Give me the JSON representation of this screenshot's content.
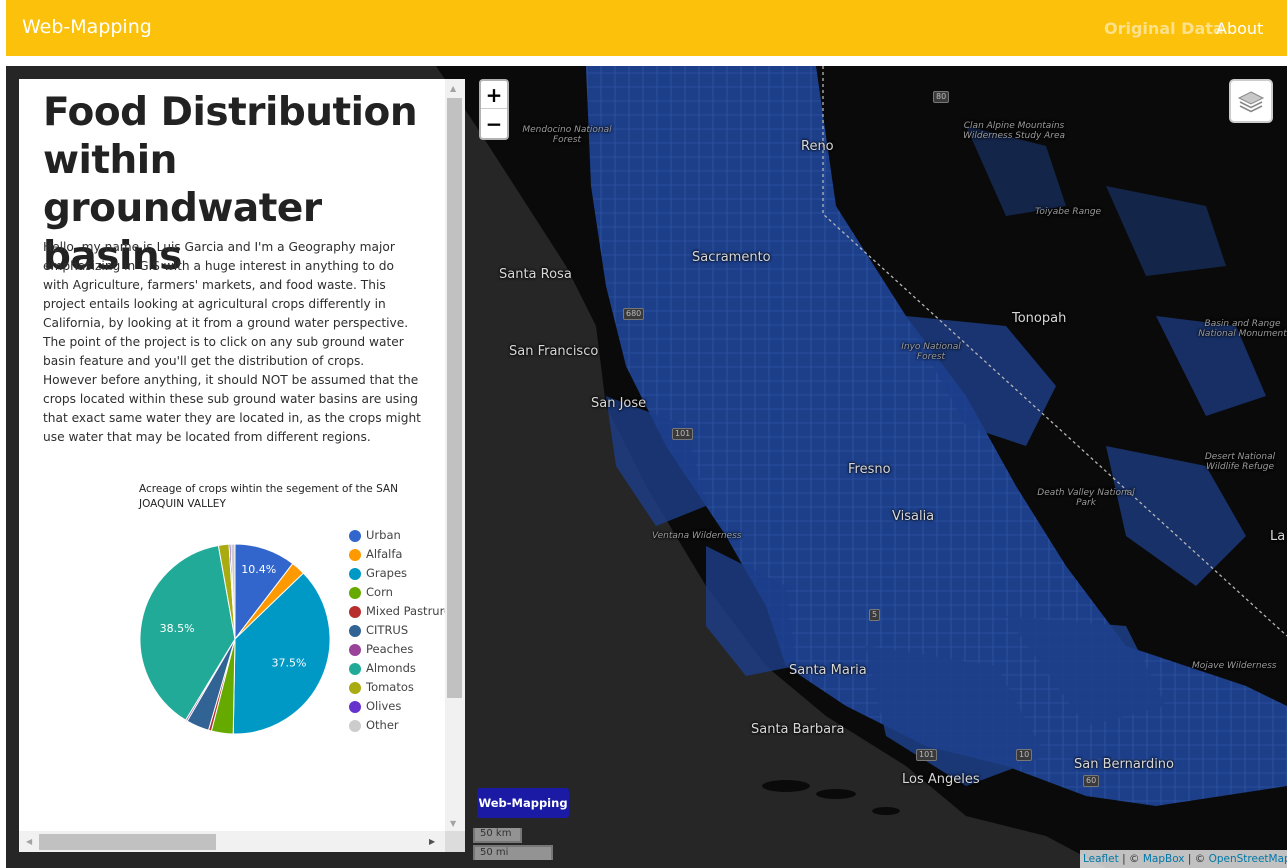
{
  "navbar": {
    "brand": "Web-Mapping",
    "links": [
      "Original Data",
      "About"
    ],
    "color": "#fcc10a"
  },
  "sidebar": {
    "title": "Food Distribution within groundwater basins",
    "intro": "Hello, my name is Luis Garcia and I'm a Geography major emphasizing in GIS with a huge interest in anything to do with Agriculture, farmers' markets, and food waste. This project entails looking at agricultural crops differently in California, by looking at it from a ground water perspective. The point of the project is to click on any sub ground water basin feature and you'll get the distribution of crops. However before anything, it should NOT be assumed that the crops located within these sub ground water basins are using that exact same water they are located in, as the crops might use water that may be located from different regions."
  },
  "chart_data": {
    "type": "pie",
    "title": "Acreage of crops wihtin the segement of the SAN JOAQUIN VALLEY",
    "labels": [
      "Urban",
      "Alfalfa",
      "Grapes",
      "Corn",
      "Mixed Pastrure",
      "CITRUS",
      "Peaches",
      "Almonds",
      "Tomatos",
      "Olives",
      "Other"
    ],
    "values": [
      10.4,
      2.4,
      37.5,
      3.7,
      0.5,
      3.9,
      0.3,
      38.5,
      1.8,
      0.3,
      0.7
    ],
    "colors": [
      "#3366cc",
      "#ff9900",
      "#0099c6",
      "#66aa00",
      "#b82e2e",
      "#316395",
      "#994499",
      "#22aa99",
      "#aaaa11",
      "#6633cc",
      "#cccccc"
    ],
    "data_labels": [
      "10.4%",
      "37.5%",
      "38.5%"
    ],
    "legend": "right"
  },
  "map": {
    "labels": [
      {
        "text": "Reno",
        "cls": ""
      },
      {
        "text": "Sacramento",
        "cls": ""
      },
      {
        "text": "Santa Rosa",
        "cls": ""
      },
      {
        "text": "San Francisco",
        "cls": ""
      },
      {
        "text": "San Jose",
        "cls": ""
      },
      {
        "text": "Tonopah",
        "cls": ""
      },
      {
        "text": "Fresno",
        "cls": ""
      },
      {
        "text": "Visalia",
        "cls": ""
      },
      {
        "text": "Santa Maria",
        "cls": ""
      },
      {
        "text": "Santa Barbara",
        "cls": ""
      },
      {
        "text": "Los Angeles",
        "cls": ""
      },
      {
        "text": "San Bernardino",
        "cls": ""
      },
      {
        "text": "La",
        "cls": ""
      },
      {
        "text": "Mendocino National Forest",
        "cls": "small"
      },
      {
        "text": "Clan Alpine Mountains Wilderness Study Area",
        "cls": "small"
      },
      {
        "text": "Toiyabe Range",
        "cls": "small"
      },
      {
        "text": "Inyo National Forest",
        "cls": "small"
      },
      {
        "text": "Basin and Range National Monument",
        "cls": "small"
      },
      {
        "text": "Desert National Wildlife Refuge",
        "cls": "small"
      },
      {
        "text": "Death Valley National Park",
        "cls": "small"
      },
      {
        "text": "Ventana Wilderness",
        "cls": "small"
      },
      {
        "text": "Mojave Wilderness",
        "cls": "small"
      }
    ],
    "shields": [
      "80",
      "680",
      "101",
      "5",
      "101",
      "10",
      "60"
    ],
    "zoom_in": "+",
    "zoom_out": "−",
    "layers_icon": "layers-icon",
    "control_button": "Web-Mapping",
    "scale": {
      "km": "50 km",
      "mi": "50 mi"
    },
    "attribution": {
      "leaflet": "Leaflet",
      "mapbox": "MapBox",
      "osm": "OpenStreetMap",
      "sep1": " | © ",
      "sep2": " | © "
    }
  }
}
